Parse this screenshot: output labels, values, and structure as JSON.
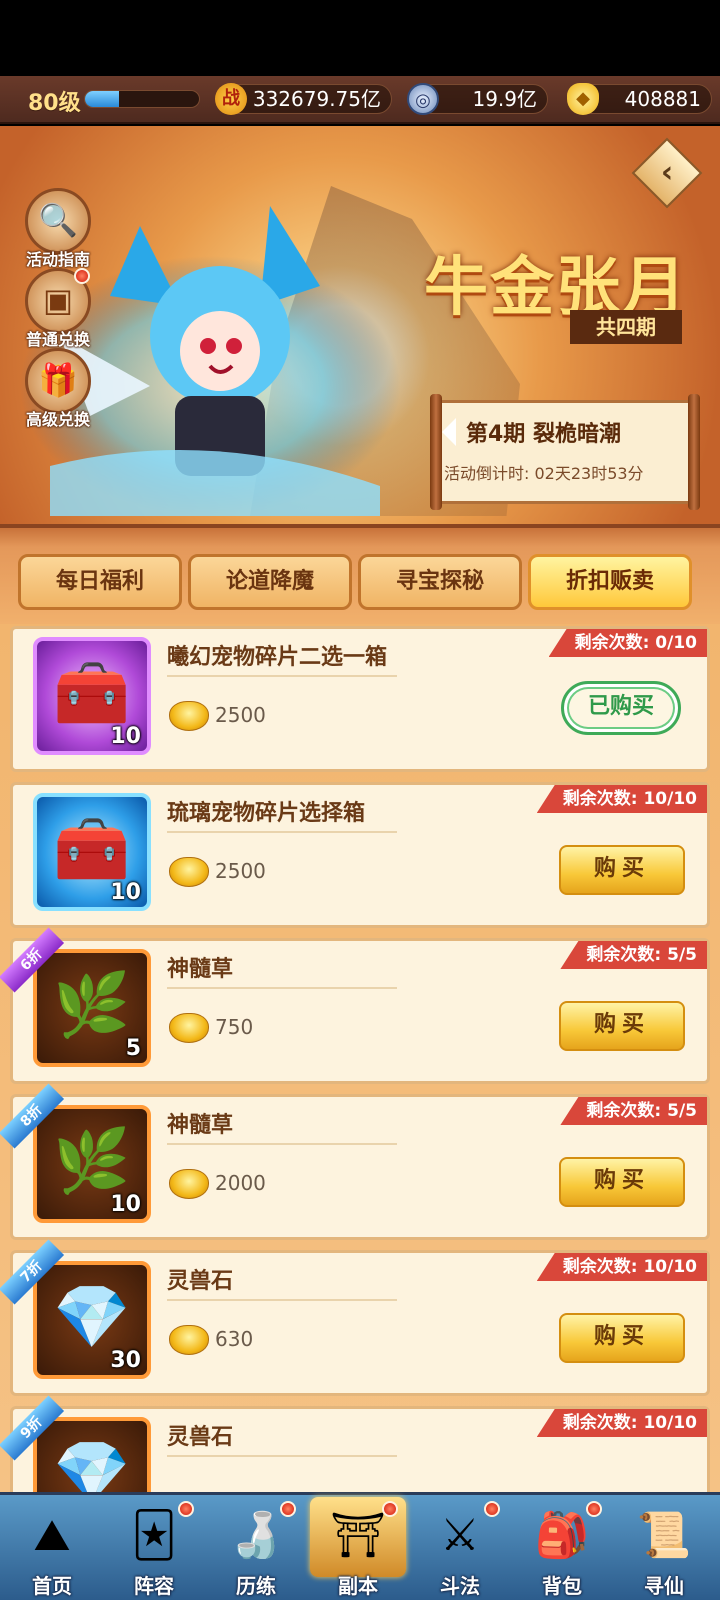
{
  "top": {
    "level": "80级",
    "xp_fraction": 0.3,
    "power": "332679.75亿",
    "coin": "19.9亿",
    "ingot": "408881",
    "power_icon": "战"
  },
  "banner": {
    "title": "牛金张月",
    "subtitle": "共四期",
    "side_buttons": [
      {
        "label": "活动指南",
        "icon": "magnifier-icon"
      },
      {
        "label": "普通兑换",
        "icon": "box-icon",
        "dot": true
      },
      {
        "label": "高级兑换",
        "icon": "gift-icon"
      }
    ],
    "period_title": "第4期  裂桅暗潮",
    "countdown": "活动倒计时: 02天23时53分"
  },
  "tabs": [
    "每日福利",
    "论道降魔",
    "寻宝探秘",
    "折扣贩卖"
  ],
  "active_tab": 3,
  "items": [
    {
      "name": "曦幻宠物碎片二选一箱",
      "price": "2500",
      "qty": "10",
      "remain": "剩余次数: 0/10",
      "status": "已购买",
      "discount": ""
    },
    {
      "name": "琉璃宠物碎片选择箱",
      "price": "2500",
      "qty": "10",
      "remain": "剩余次数: 10/10",
      "status": "购买",
      "discount": ""
    },
    {
      "name": "神髓草",
      "price": "750",
      "qty": "5",
      "remain": "剩余次数: 5/5",
      "status": "购买",
      "discount": "6折"
    },
    {
      "name": "神髓草",
      "price": "2000",
      "qty": "10",
      "remain": "剩余次数: 5/5",
      "status": "购买",
      "discount": "8折"
    },
    {
      "name": "灵兽石",
      "price": "630",
      "qty": "30",
      "remain": "剩余次数: 10/10",
      "status": "购买",
      "discount": "7折"
    },
    {
      "name": "灵兽石",
      "price": "",
      "qty": "",
      "remain": "剩余次数: 10/10",
      "status": "",
      "discount": "9折"
    }
  ],
  "nav": [
    {
      "label": "首页",
      "dot": false
    },
    {
      "label": "阵容",
      "dot": true
    },
    {
      "label": "历练",
      "dot": true
    },
    {
      "label": "副本",
      "dot": true
    },
    {
      "label": "斗法",
      "dot": true
    },
    {
      "label": "背包",
      "dot": true
    },
    {
      "label": "寻仙",
      "dot": false
    }
  ],
  "colors": {
    "accent": "#ffc83a",
    "badge_red": "#d9473a",
    "bought_green": "#3eaa58"
  }
}
